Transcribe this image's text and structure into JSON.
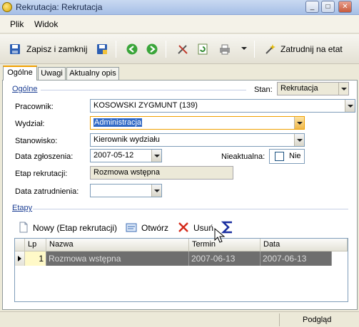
{
  "window": {
    "title": "Rekrutacja: Rekrutacja"
  },
  "menu": {
    "items": [
      "Plik",
      "Widok"
    ]
  },
  "toolbar": {
    "save_close_label": "Zapisz i zamknij",
    "hire_label": "Zatrudnij na etat"
  },
  "tabs": [
    "Ogólne",
    "Uwagi",
    "Aktualny opis"
  ],
  "general": {
    "section_label": "Ogólne",
    "status_label": "Stan:",
    "status_value": "Rekrutacja",
    "employee_label": "Pracownik:",
    "employee_value": "KOSOWSKI ZYGMUNT (139)",
    "department_label": "Wydział:",
    "department_value": "Administracja",
    "position_label": "Stanowisko:",
    "position_value": "Kierownik wydziału",
    "report_date_label": "Data zgłoszenia:",
    "report_date_value": "2007-05-12",
    "inactive_label": "Nieaktualna:",
    "inactive_value": "Nie",
    "stage_label": "Etap rekrutacji:",
    "stage_value": "Rozmowa wstępna",
    "hire_date_label": "Data zatrudnienia:",
    "hire_date_value": ""
  },
  "stages": {
    "section_label": "Etapy",
    "new_label": "Nowy (Etap rekrutacji)",
    "open_label": "Otwórz",
    "delete_label": "Usuń",
    "columns": [
      "Lp",
      "Nazwa",
      "Termin",
      "Data"
    ],
    "rows": [
      {
        "lp": "1",
        "name": "Rozmowa wstępna",
        "term": "2007-06-13",
        "date": "2007-06-13"
      }
    ]
  },
  "status": {
    "preview_label": "Podgląd"
  },
  "colors": {
    "accent": "#3169c6",
    "tab_highlight": "#f0a000",
    "row_selected": "#6e6e6e"
  }
}
